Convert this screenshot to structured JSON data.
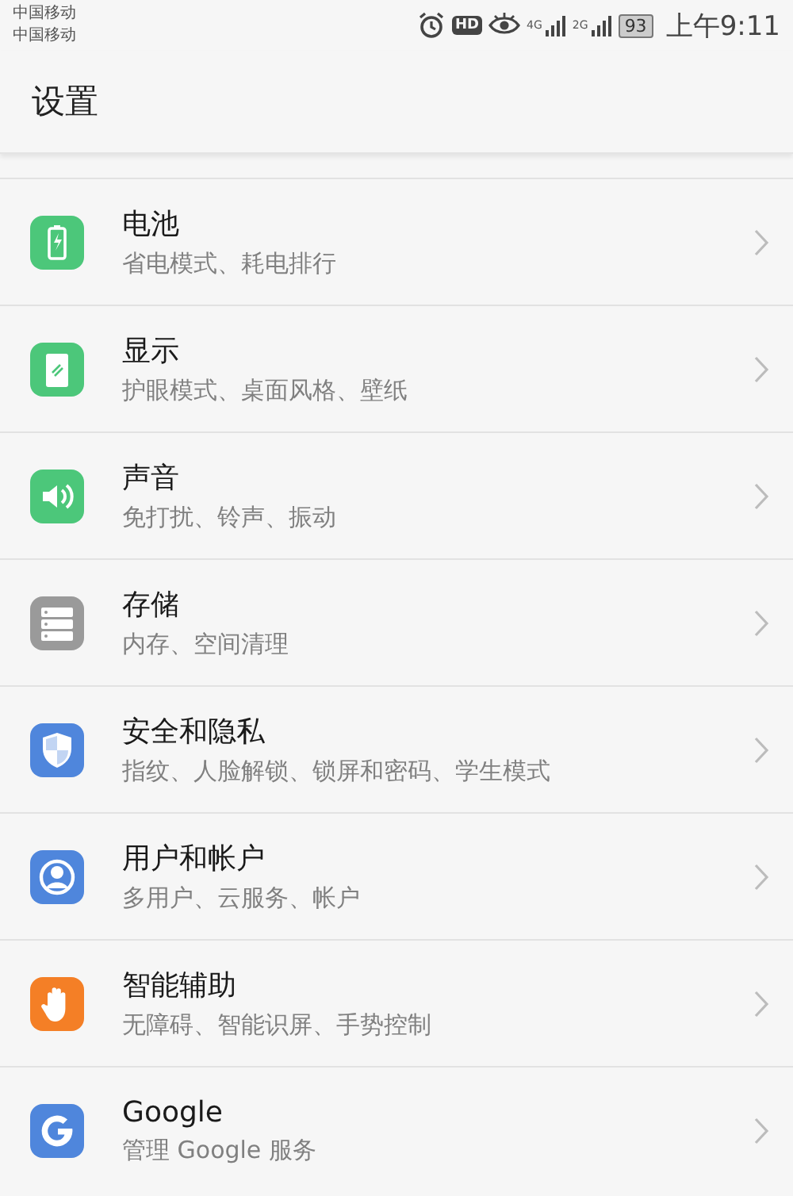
{
  "status_bar": {
    "carriers": [
      "中国移动",
      "中国移动"
    ],
    "hd": "HD",
    "network_1": "4G",
    "network_2": "2G",
    "battery": "93",
    "time": "上午9:11"
  },
  "header": {
    "title": "设置"
  },
  "items": [
    {
      "kind": "battery",
      "color": "#4cc77a",
      "title": "电池",
      "subtitle": "省电模式、耗电排行"
    },
    {
      "kind": "display",
      "color": "#4cc77a",
      "title": "显示",
      "subtitle": "护眼模式、桌面风格、壁纸"
    },
    {
      "kind": "sound",
      "color": "#4cc77a",
      "title": "声音",
      "subtitle": "免打扰、铃声、振动"
    },
    {
      "kind": "storage",
      "color": "#9a9a9a",
      "title": "存储",
      "subtitle": "内存、空间清理"
    },
    {
      "kind": "shield",
      "color": "#4f86dc",
      "title": "安全和隐私",
      "subtitle": "指纹、人脸解锁、锁屏和密码、学生模式"
    },
    {
      "kind": "user",
      "color": "#4f86dc",
      "title": "用户和帐户",
      "subtitle": "多用户、云服务、帐户"
    },
    {
      "kind": "hand",
      "color": "#f47f26",
      "title": "智能辅助",
      "subtitle": "无障碍、智能识屏、手势控制"
    },
    {
      "kind": "google",
      "color": "#4f86dc",
      "title": "Google",
      "subtitle": "管理 Google 服务"
    }
  ]
}
